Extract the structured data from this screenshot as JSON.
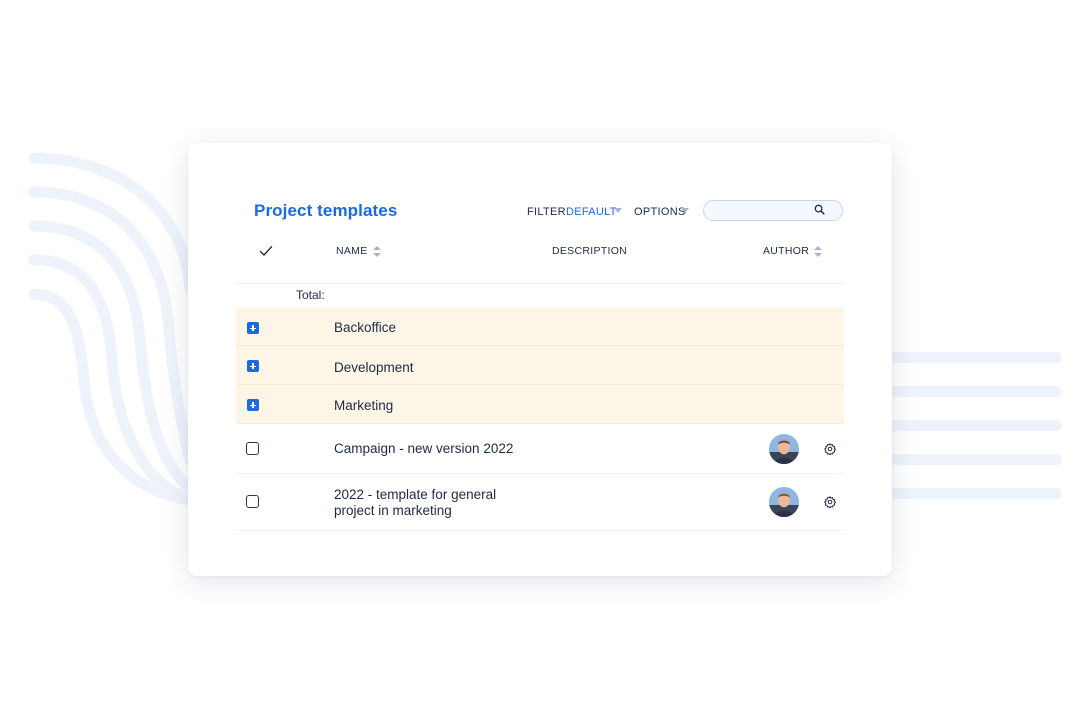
{
  "page": {
    "title": "Project templates",
    "filter_label": "FILTER",
    "filter_value": "DEFAULT",
    "options_label": "OPTIONS",
    "search_placeholder": ""
  },
  "table": {
    "columns": {
      "name": "NAME",
      "description": "DESCRIPTION",
      "author": "AUTHOR"
    },
    "total_label": "Total:",
    "groups": [
      {
        "label": "Backoffice"
      },
      {
        "label": "Development"
      },
      {
        "label": "Marketing"
      }
    ],
    "items": [
      {
        "name": "Campaign - new version 2022",
        "name_line2": "",
        "description": ""
      },
      {
        "name": "2022 - template for general",
        "name_line2": "project in marketing",
        "description": ""
      }
    ]
  },
  "icons": {
    "header_check": "check-icon",
    "sort": "sort-icon",
    "search": "search-icon",
    "expand": "plus-square-icon",
    "settings": "gear-icon",
    "avatar": "user-avatar"
  },
  "colors": {
    "accent": "#1a6be0",
    "group_row_bg": "#fdf6e6",
    "text": "#1f2a44"
  }
}
